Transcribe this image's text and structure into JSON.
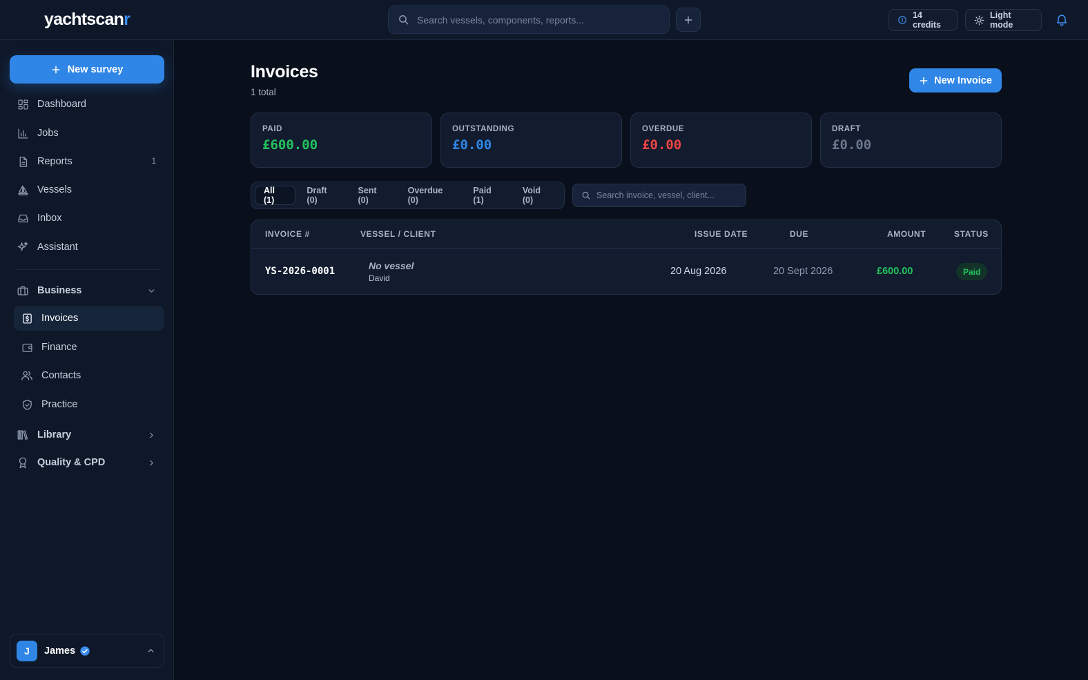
{
  "app": {
    "logo_main": "yachtscan",
    "logo_accent": "r"
  },
  "topbar": {
    "search_placeholder": "Search vessels, components, reports...",
    "credits": "14 credits",
    "light_mode": "Light mode"
  },
  "sidebar": {
    "new_survey": "New survey",
    "items": [
      {
        "label": "Dashboard",
        "icon": "dashboard-icon"
      },
      {
        "label": "Jobs",
        "icon": "bar-chart-icon"
      },
      {
        "label": "Reports",
        "icon": "document-icon",
        "count": "1"
      },
      {
        "label": "Vessels",
        "icon": "sailboat-icon"
      },
      {
        "label": "Inbox",
        "icon": "inbox-icon"
      },
      {
        "label": "Assistant",
        "icon": "sparkles-icon"
      }
    ],
    "business": {
      "label": "Business",
      "items": [
        {
          "label": "Invoices",
          "icon": "invoice-dollar-icon",
          "active": true
        },
        {
          "label": "Finance",
          "icon": "wallet-icon"
        },
        {
          "label": "Contacts",
          "icon": "users-icon"
        },
        {
          "label": "Practice",
          "icon": "shield-icon"
        }
      ]
    },
    "library": "Library",
    "quality": "Quality & CPD",
    "user": {
      "initial": "J",
      "name": "James"
    }
  },
  "main": {
    "title": "Invoices",
    "subtitle": "1 total",
    "new_invoice": "New Invoice",
    "stats": [
      {
        "label": "PAID",
        "value": "£600.00",
        "color": "#22c35e"
      },
      {
        "label": "OUTSTANDING",
        "value": "£0.00",
        "color": "#2f86e6"
      },
      {
        "label": "OVERDUE",
        "value": "£0.00",
        "color": "#ef4444"
      },
      {
        "label": "DRAFT",
        "value": "£0.00",
        "color": "#6b778b"
      }
    ],
    "tabs": [
      "All (1)",
      "Draft (0)",
      "Sent (0)",
      "Overdue (0)",
      "Paid (1)",
      "Void (0)"
    ],
    "active_tab": "All (1)",
    "filter_placeholder": "Search invoice, vessel, client...",
    "table": {
      "columns": [
        "INVOICE #",
        "VESSEL / CLIENT",
        "ISSUE DATE",
        "DUE",
        "AMOUNT",
        "STATUS"
      ],
      "rows": [
        {
          "invoice_no": "YS-2026-0001",
          "vessel": "No vessel",
          "client": "David",
          "issue_date": "20 Aug 2026",
          "due": "20 Sept 2026",
          "amount": "£600.00",
          "status": "Paid"
        }
      ]
    }
  }
}
